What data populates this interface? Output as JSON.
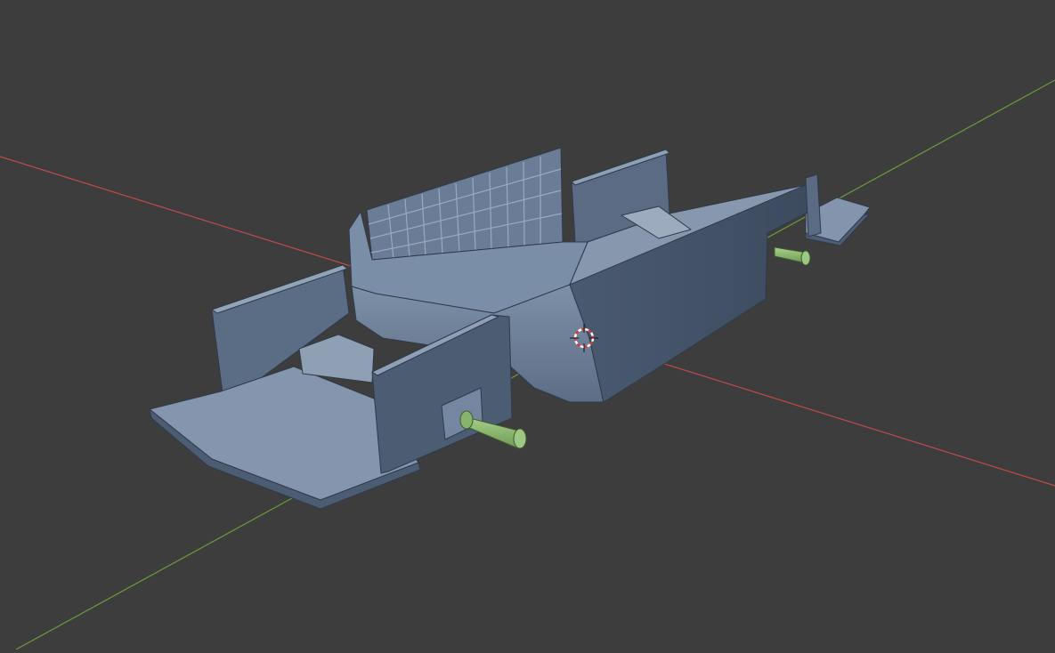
{
  "viewport": {
    "view": "3D Viewport",
    "background_color": "#3d3d3d",
    "shading": "solid"
  },
  "axes": {
    "x_axis_color": "#c24b4b",
    "y_axis_color": "#6f9a37"
  },
  "scene_objects": [
    {
      "name": "chassis",
      "color": "#7d8ea6"
    },
    {
      "name": "axle-front",
      "color": "#96c07a"
    },
    {
      "name": "axle-rear",
      "color": "#96c07a"
    }
  ],
  "cursor": {
    "name": "3d-cursor-icon"
  }
}
